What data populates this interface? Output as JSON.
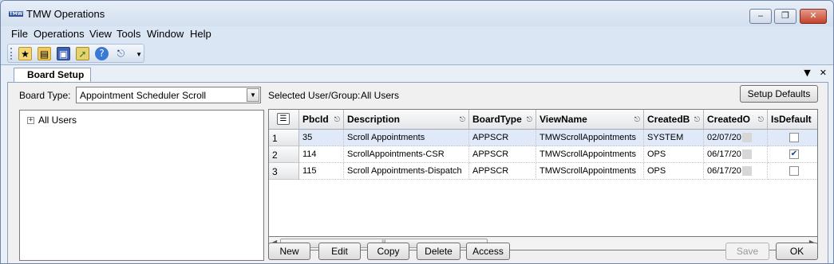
{
  "window": {
    "title": "TMW Operations",
    "icon_text": "TMW"
  },
  "menu": [
    "File",
    "Operations",
    "View",
    "Tools",
    "Window",
    "Help"
  ],
  "toolbar": {
    "icons": [
      "new-icon",
      "open-icon",
      "save-icon",
      "export-icon",
      "help-icon",
      "exit-icon"
    ]
  },
  "tab": {
    "label": "Board Setup"
  },
  "panel": {
    "board_type_label": "Board Type:",
    "board_type_value": "Appointment Scheduler Scroll",
    "selected_label": "Selected User/Group:",
    "selected_value": "All Users",
    "setup_defaults": "Setup Defaults",
    "tree_root": "All Users"
  },
  "grid": {
    "columns": [
      "PbcId",
      "Description",
      "BoardType",
      "ViewName",
      "CreatedB",
      "CreatedO",
      "IsDefault"
    ],
    "rows": [
      {
        "n": "1",
        "PbcId": "35",
        "Description": "Scroll Appointments",
        "BoardType": "APPSCR",
        "ViewName": "TMWScrollAppointments",
        "CreatedBy": "SYSTEM",
        "CreatedOn": "02/07/20",
        "IsDefault": false
      },
      {
        "n": "2",
        "PbcId": "114",
        "Description": "ScrollAppointments-CSR",
        "BoardType": "APPSCR",
        "ViewName": "TMWScrollAppointments",
        "CreatedBy": "OPS",
        "CreatedOn": "06/17/20",
        "IsDefault": true
      },
      {
        "n": "3",
        "PbcId": "115",
        "Description": "Scroll Appointments-Dispatch",
        "BoardType": "APPSCR",
        "ViewName": "TMWScrollAppointments",
        "CreatedBy": "OPS",
        "CreatedOn": "06/17/20",
        "IsDefault": false
      }
    ]
  },
  "buttons": {
    "new": "New",
    "edit": "Edit",
    "copy": "Copy",
    "delete": "Delete",
    "access": "Access",
    "save": "Save",
    "ok": "OK"
  }
}
